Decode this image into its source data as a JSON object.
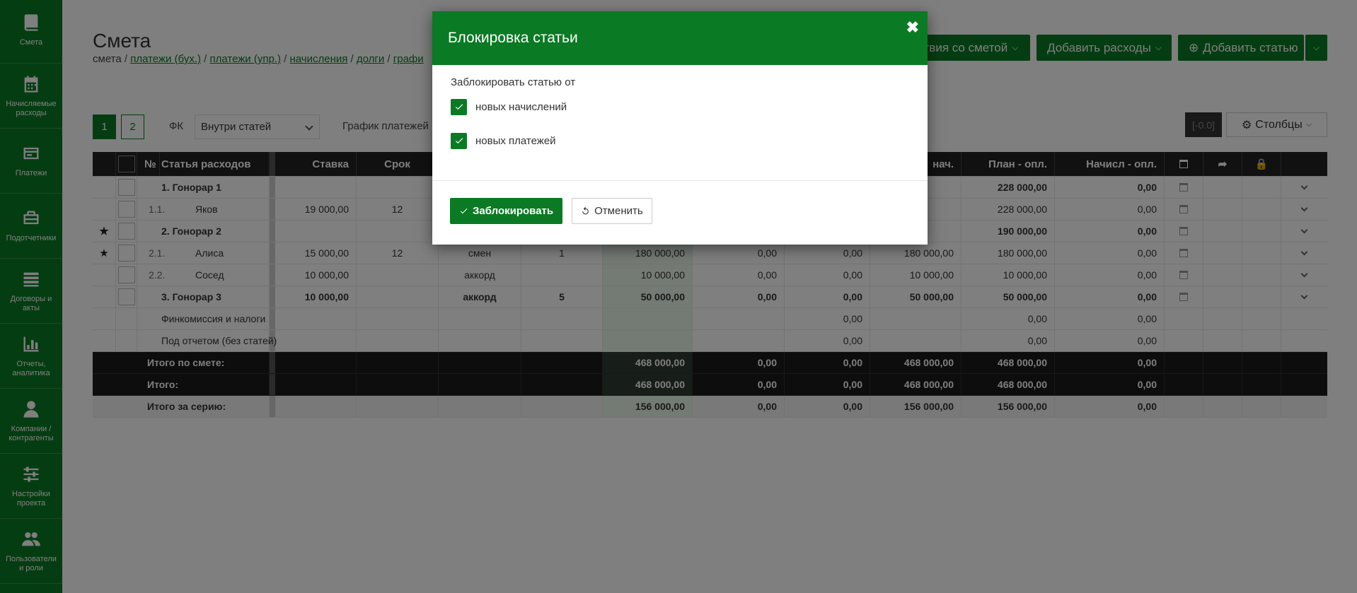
{
  "sidebar": {
    "items": [
      {
        "label": "Смета",
        "icon": "book-icon"
      },
      {
        "label": "Начисляемые расходы",
        "icon": "calendar-icon"
      },
      {
        "label": "Платежи",
        "icon": "payments-icon"
      },
      {
        "label": "Подотчетники",
        "icon": "briefcase-icon"
      },
      {
        "label": "Договоры и акты",
        "icon": "list-icon"
      },
      {
        "label": "Отчеты, аналитика",
        "icon": "bar-chart-icon"
      },
      {
        "label": "Компании / контрагенты",
        "icon": "user-icon"
      },
      {
        "label": "Настройки проекта",
        "icon": "sliders-icon"
      },
      {
        "label": "Пользователи и роли",
        "icon": "users-icon"
      }
    ]
  },
  "page": {
    "title": "Смета",
    "breadcrumb": {
      "current": "смета",
      "links": [
        "платежи (бух.)",
        "платежи (упр.)",
        "начисления",
        "долги",
        "графи"
      ]
    }
  },
  "toolbar": {
    "actions_label": "ствия со сметой",
    "add_expenses_label": "Добавить расходы",
    "add_article_label": "Добавить статью"
  },
  "filters": {
    "pages": [
      "1",
      "2"
    ],
    "fk_label": "ФК",
    "fk_value": "Внутри статей",
    "schedule_label": "График платежей",
    "zoom_value": "[-0.0]",
    "columns_label": "Столбцы"
  },
  "table": {
    "headers": {
      "num": "№",
      "article": "Статья расходов",
      "rate": "Ставка",
      "term": "Срок",
      "accrued": "нач.",
      "plan_paid": "План - опл.",
      "accrued_paid": "Начисл - опл."
    },
    "rows": [
      {
        "type": "group",
        "star": "",
        "num": "",
        "name": "1. Гонорар 1",
        "rate": "",
        "term": "",
        "unit": "",
        "qty": "",
        "v1": "",
        "v2": "",
        "v3": "",
        "v4": "",
        "v5": "228 000,00",
        "v6": "0,00"
      },
      {
        "type": "item",
        "star": "",
        "num": "1.1.",
        "name": "Яков",
        "rate": "19 000,00",
        "term": "12",
        "unit": "",
        "qty": "",
        "v1": "",
        "v2": "",
        "v3": "",
        "v4": "",
        "v5": "228 000,00",
        "v6": "0,00"
      },
      {
        "type": "group",
        "star": "★",
        "num": "",
        "name": "2. Гонорар 2",
        "rate": "",
        "term": "",
        "unit": "",
        "qty": "",
        "v1": "",
        "v2": "",
        "v3": "",
        "v4": "",
        "v5": "190 000,00",
        "v6": "0,00"
      },
      {
        "type": "item",
        "star": "★",
        "num": "2.1.",
        "name": "Алиса",
        "rate": "15 000,00",
        "term": "12",
        "unit": "смен",
        "qty": "1",
        "v1": "180 000,00",
        "v2": "0,00",
        "v3": "0,00",
        "v4": "180 000,00",
        "v5": "180 000,00",
        "v6": "0,00"
      },
      {
        "type": "item",
        "star": "",
        "num": "2.2.",
        "name": "Сосед",
        "rate": "10 000,00",
        "term": "",
        "unit": "аккорд",
        "qty": "",
        "v1": "10 000,00",
        "v2": "0,00",
        "v3": "0,00",
        "v4": "10 000,00",
        "v5": "10 000,00",
        "v6": "0,00"
      },
      {
        "type": "group",
        "star": "",
        "num": "",
        "name": "3. Гонорар 3",
        "rate": "10 000,00",
        "term": "",
        "unit": "аккорд",
        "qty": "5",
        "v1": "50 000,00",
        "v2": "0,00",
        "v3": "0,00",
        "v4": "50 000,00",
        "v5": "50 000,00",
        "v6": "0,00"
      },
      {
        "type": "plain",
        "star": "",
        "num": "",
        "name": "Финкомиссия и налоги",
        "rate": "",
        "term": "",
        "unit": "",
        "qty": "",
        "v1": "",
        "v2": "",
        "v3": "0,00",
        "v4": "",
        "v5": "0,00",
        "v6": "0,00"
      },
      {
        "type": "plain",
        "star": "",
        "num": "",
        "name": "Под отчетом (без статей)",
        "rate": "",
        "term": "",
        "unit": "",
        "qty": "",
        "v1": "",
        "v2": "",
        "v3": "0,00",
        "v4": "",
        "v5": "0,00",
        "v6": "0,00"
      }
    ],
    "totals": [
      {
        "type": "total",
        "name": "Итого по смете:",
        "v1": "468 000,00",
        "v2": "0,00",
        "v3": "0,00",
        "v4": "468 000,00",
        "v5": "468 000,00",
        "v6": "0,00"
      },
      {
        "type": "total",
        "name": "Итого:",
        "v1": "468 000,00",
        "v2": "0,00",
        "v3": "0,00",
        "v4": "468 000,00",
        "v5": "468 000,00",
        "v6": "0,00"
      },
      {
        "type": "series",
        "name": "Итого за серию:",
        "v1": "156 000,00",
        "v2": "0,00",
        "v3": "0,00",
        "v4": "156 000,00",
        "v5": "156 000,00",
        "v6": "0,00"
      }
    ]
  },
  "modal": {
    "title": "Блокировка статьи",
    "close_icon": "close-icon",
    "intro": "Заблокировать статью от",
    "options": [
      {
        "label": "новых начислений",
        "checked": true
      },
      {
        "label": "новых платежей",
        "checked": true
      }
    ],
    "confirm_label": "Заблокировать",
    "cancel_label": "Отменить"
  },
  "colors": {
    "brand_green": "#0b7a24",
    "overlay": "rgba(0,0,0,0.5)"
  }
}
